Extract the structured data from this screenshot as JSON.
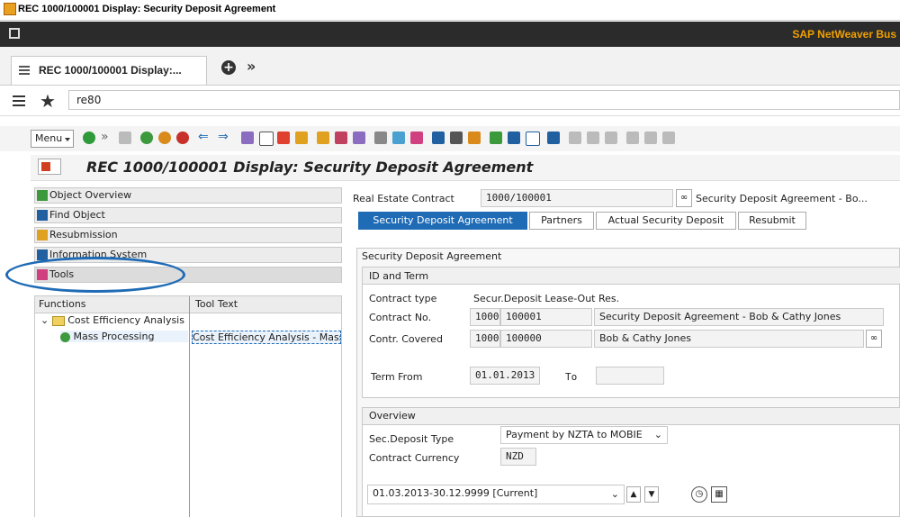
{
  "window": {
    "title": "REC 1000/100001 Display: Security Deposit Agreement",
    "brand": "SAP NetWeaver Bus"
  },
  "tabs": {
    "current": "REC 1000/100001 Display:...",
    "more": "»"
  },
  "command": {
    "value": "re80"
  },
  "toolbar": {
    "menu_label": "Menu"
  },
  "page": {
    "title": "REC 1000/100001 Display: Security Deposit Agreement"
  },
  "nav": {
    "items": [
      {
        "label": "Object Overview"
      },
      {
        "label": "Find Object"
      },
      {
        "label": "Resubmission"
      },
      {
        "label": "Information System"
      },
      {
        "label": "Tools"
      }
    ]
  },
  "tree": {
    "headers": [
      "Functions",
      "Tool Text"
    ],
    "folder": "Cost Efficiency Analysis",
    "item": "Mass Processing",
    "item_text": "Cost Efficiency Analysis - Mass I"
  },
  "contract": {
    "label": "Real Estate Contract",
    "value": "1000/100001",
    "desc": "Security Deposit Agreement - Bo..."
  },
  "subtabs": [
    "Security Deposit Agreement",
    "Partners",
    "Actual Security Deposit",
    "Resubmit"
  ],
  "form": {
    "section_title": "Security Deposit Agreement",
    "id_term": {
      "title": "ID and Term",
      "contract_type_label": "Contract type",
      "contract_type_value": "Secur.Deposit Lease-Out Res.",
      "contract_no_label": "Contract No.",
      "contract_no_1": "1000",
      "contract_no_2": "100001",
      "contract_no_desc": "Security Deposit Agreement - Bob & Cathy Jones",
      "covered_label": "Contr. Covered",
      "covered_1": "1000",
      "covered_2": "100000",
      "covered_desc": "Bob & Cathy Jones",
      "term_from_label": "Term From",
      "term_from_value": "01.01.2013",
      "to_label": "To",
      "to_value": ""
    },
    "overview": {
      "title": "Overview",
      "deposit_type_label": "Sec.Deposit Type",
      "deposit_type_value": "Payment by NZTA to MOBIE",
      "currency_label": "Contract Currency",
      "currency_value": "NZD",
      "period_value": "01.03.2013-30.12.9999 [Current]"
    }
  }
}
